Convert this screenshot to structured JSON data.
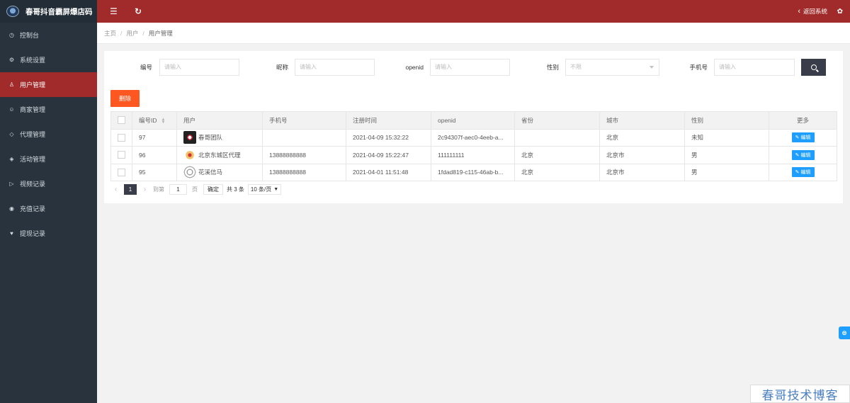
{
  "app": {
    "title": "春哥抖音霸屏爆店码"
  },
  "sidebar": {
    "items": [
      {
        "label": "控制台",
        "icon": "dashboard-icon",
        "glyph": "◷"
      },
      {
        "label": "系统设置",
        "icon": "gear-icon",
        "glyph": "⚙"
      },
      {
        "label": "用户管理",
        "icon": "user-icon",
        "glyph": "♙",
        "active": true
      },
      {
        "label": "商家管理",
        "icon": "smile-icon",
        "glyph": "☺"
      },
      {
        "label": "代理管理",
        "icon": "diamond-icon",
        "glyph": "◇"
      },
      {
        "label": "活动管理",
        "icon": "tag-icon",
        "glyph": "◈"
      },
      {
        "label": "视频记录",
        "icon": "video-icon",
        "glyph": "▷"
      },
      {
        "label": "充值记录",
        "icon": "coin-icon",
        "glyph": "◉"
      },
      {
        "label": "提现记录",
        "icon": "heart-icon",
        "glyph": "♥"
      }
    ]
  },
  "topbar": {
    "menu_icon": "menu-icon",
    "refresh_icon": "refresh-icon",
    "back_label": "返回系统",
    "theme_icon": "palette-icon"
  },
  "breadcrumb": {
    "home": "主页",
    "parent": "用户",
    "current": "用户管理"
  },
  "filters": {
    "id_label": "编号",
    "id_placeholder": "请输入",
    "nickname_label": "昵称",
    "nickname_placeholder": "请输入",
    "openid_label": "openid",
    "openid_placeholder": "请输入",
    "gender_label": "性别",
    "gender_value": "不限",
    "phone_label": "手机号",
    "phone_placeholder": "请输入",
    "search_icon": "search-icon"
  },
  "actions": {
    "delete_label": "删除"
  },
  "table": {
    "headers": {
      "id": "编号ID",
      "user": "用户",
      "phone": "手机号",
      "reg_time": "注册时间",
      "openid": "openid",
      "province": "省份",
      "city": "城市",
      "gender": "性别",
      "more": "更多"
    },
    "rows": [
      {
        "id": "97",
        "user": "春哥团队",
        "avatar": "avatar-icon",
        "phone": "",
        "reg_time": "2021-04-09 15:32:22",
        "openid": "2c94307f-aec0-4eeb-a...",
        "province": "",
        "city": "北京",
        "gender": "未知",
        "edit": "编辑"
      },
      {
        "id": "96",
        "user": "北京东城区代理",
        "avatar": "avatar-icon",
        "phone": "13888888888",
        "reg_time": "2021-04-09 15:22:47",
        "openid": "111111111",
        "province": "北京",
        "city": "北京市",
        "gender": "男",
        "edit": "编辑"
      },
      {
        "id": "95",
        "user": "花溪信马",
        "avatar": "avatar-icon",
        "phone": "13888888888",
        "reg_time": "2021-04-01 11:51:48",
        "openid": "1fdad819-c115-46ab-b...",
        "province": "北京",
        "city": "北京市",
        "gender": "男",
        "edit": "编辑"
      }
    ]
  },
  "pagination": {
    "current_page": "1",
    "goto_label": "到第",
    "goto_value": "1",
    "page_unit": "页",
    "confirm_label": "确定",
    "total_label": "共 3 条",
    "page_size": "10 条/页"
  },
  "watermark": {
    "text": "春哥技术博客"
  },
  "colors": {
    "topbar": "#a12b2b",
    "sidebar": "#28333e",
    "active": "#a12b2b",
    "delete": "#ff5722",
    "edit": "#1e9fff",
    "search": "#393d49"
  }
}
